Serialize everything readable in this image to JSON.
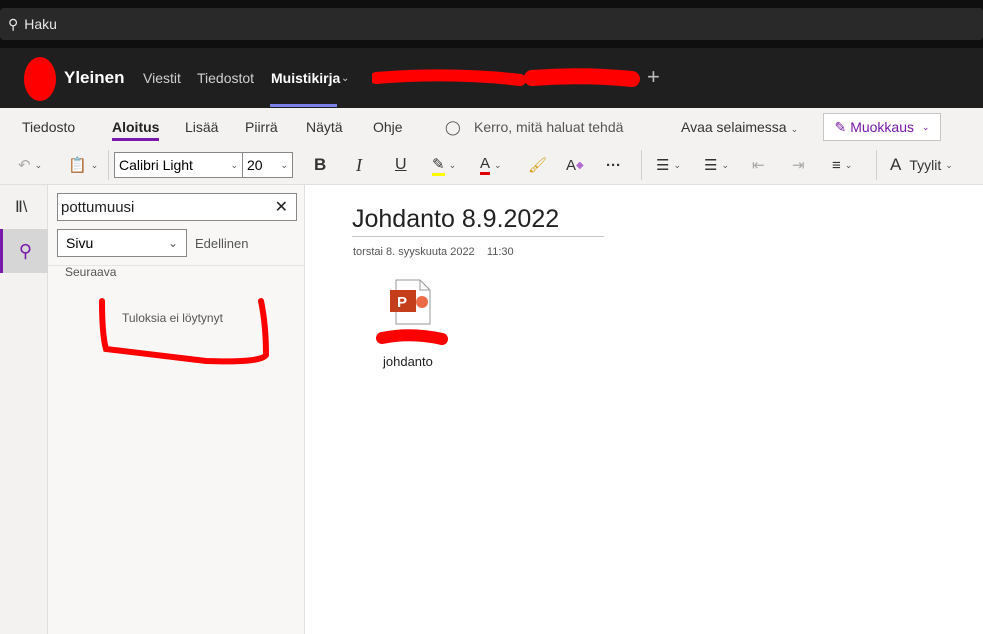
{
  "search": {
    "placeholder": "Haku"
  },
  "header": {
    "brand": "Yleinen",
    "tabs": [
      "Viestit",
      "Tiedostot",
      "Muistikirja"
    ],
    "active_tab": "Muistikirja"
  },
  "ribbon": {
    "tabs": [
      "Tiedosto",
      "Aloitus",
      "Lisää",
      "Piirrä",
      "Näytä",
      "Ohje"
    ],
    "selected_tab": "Aloitus",
    "tell_me": "Kerro, mitä haluat tehdä",
    "open_in_browser": "Avaa selaimessa",
    "edit_mode": "Muokkaus",
    "font": "Calibri Light",
    "size": "20",
    "bold": "B",
    "italic": "I",
    "underline": "U",
    "styles": "Tyylit"
  },
  "colors": {
    "accent": "#7719aa",
    "highlight": "#ffff00",
    "font_color": "#e00000",
    "tab_underline": "#7b83eb"
  },
  "search_panel": {
    "query": "pottumuusi",
    "scope": "Sivu",
    "previous": "Edellinen",
    "next": "Seuraava",
    "no_results": "Tuloksia ei löytynyt"
  },
  "page": {
    "title": "Johdanto 8.9.2022",
    "date": "torstai 8. syyskuuta 2022",
    "time": "11:30",
    "attachment": "johdanto"
  }
}
